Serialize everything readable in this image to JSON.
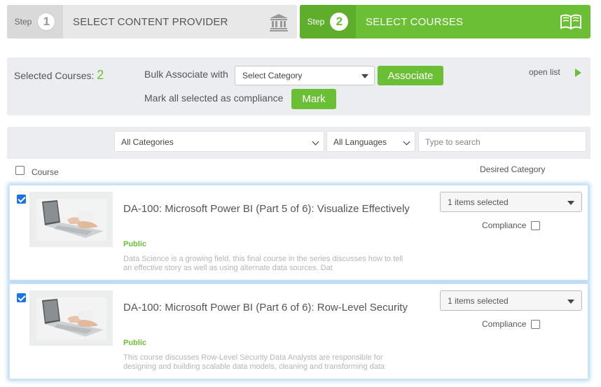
{
  "steps": [
    {
      "word": "Step",
      "number": "1",
      "title": "SELECT CONTENT PROVIDER",
      "icon": "bank-icon",
      "state": "inactive"
    },
    {
      "word": "Step",
      "number": "2",
      "title": "SELECT COURSES",
      "icon": "open-book-icon",
      "state": "active"
    }
  ],
  "bulk": {
    "selected_label": "Selected Courses:",
    "selected_count": "2",
    "associate_label": "Bulk Associate with",
    "category_select_value": "Select Category",
    "associate_button": "Associate",
    "mark_label": "Mark all selected as compliance",
    "mark_button": "Mark",
    "open_list": "open list"
  },
  "filters": {
    "category": "All Categories",
    "language": "All Languages",
    "search_placeholder": "Type to search"
  },
  "list_header": {
    "course": "Course",
    "desired_category": "Desired Category"
  },
  "courses": [
    {
      "checked": true,
      "title": "DA-100: Microsoft Power BI (Part 5 of 6): Visualize Effectively",
      "visibility": "Public",
      "description": "Data Science is a growing field, this final course in the series discusses how to tell an effective story as well as using alternate data sources. Dat",
      "category_select": "1 items selected",
      "compliance_label": "Compliance",
      "compliance_checked": false
    },
    {
      "checked": true,
      "title": "DA-100: Microsoft Power BI (Part 6 of 6): Row-Level Security",
      "visibility": "Public",
      "description": "This course discusses Row-Level Security Data Analysts are responsible for designing and building scalable data models, cleaning and transforming data",
      "category_select": "1 items selected",
      "compliance_label": "Compliance",
      "compliance_checked": false
    }
  ],
  "colors": {
    "accent_green": "#6bbf35",
    "panel_gray": "#ebedf0",
    "row_glow": "#a9d2f2"
  }
}
